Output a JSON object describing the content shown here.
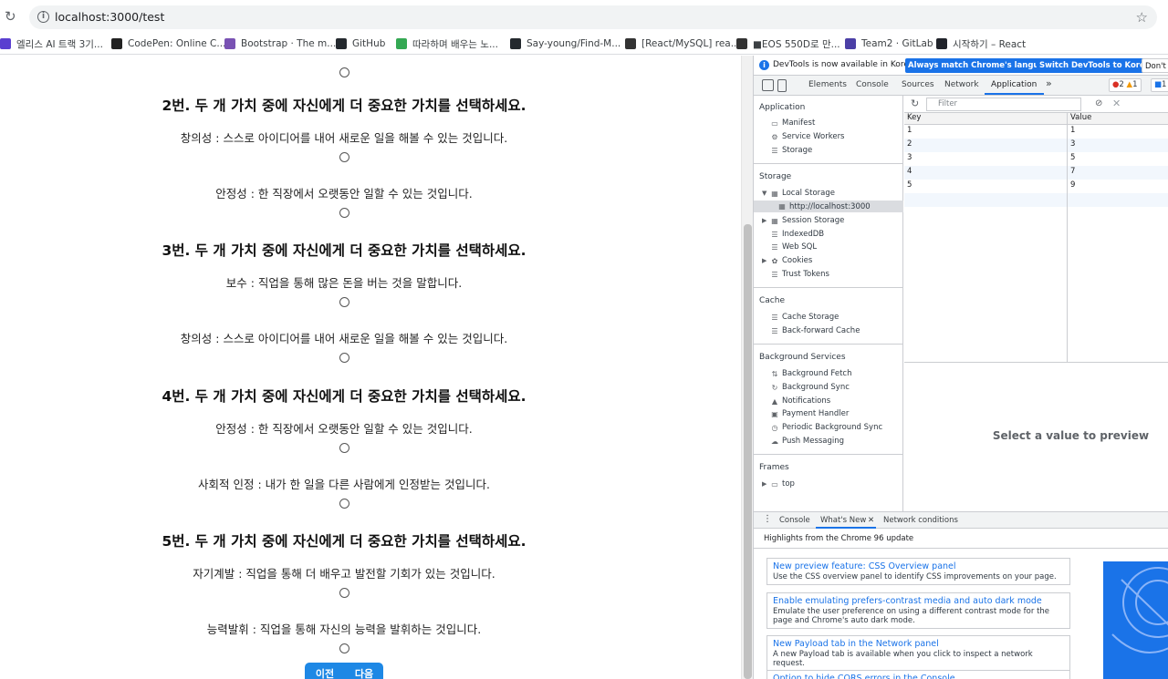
{
  "browser": {
    "url": "localhost:3000/test",
    "bookmarks": [
      {
        "label": "엘리스 AI 트랙 3기...",
        "icon": "elice-icon",
        "color": "#5a3fd0"
      },
      {
        "label": "CodePen: Online C...",
        "icon": "codepen-icon",
        "color": "#222222"
      },
      {
        "label": "Bootstrap · The m...",
        "icon": "bootstrap-icon",
        "color": "#7952b3"
      },
      {
        "label": "GitHub",
        "icon": "github-icon",
        "color": "#24292e"
      },
      {
        "label": "따라하며 배우는 노...",
        "icon": "leaf-icon",
        "color": "#34a853"
      },
      {
        "label": "Say-young/Find-M...",
        "icon": "github-icon",
        "color": "#24292e"
      },
      {
        "label": "[React/MySQL] rea...",
        "icon": "velog-icon",
        "color": "#333333"
      },
      {
        "label": "■EOS 550D로 만...",
        "icon": "velog-icon",
        "color": "#333333"
      },
      {
        "label": "Team2 · GitLab",
        "icon": "gitlab-icon",
        "color": "#4b3fa6"
      },
      {
        "label": "시작하기 – React",
        "icon": "react-icon",
        "color": "#20232a"
      }
    ]
  },
  "test": {
    "questions": [
      {
        "title": "2번. 두 개 가치 중에 자신에게 더 중요한 가치를 선택하세요.",
        "options": [
          "창의성 : 스스로 아이디어를 내어 새로운 일을 해볼 수 있는 것입니다.",
          "안정성 : 한 직장에서 오랫동안 일할 수 있는 것입니다."
        ]
      },
      {
        "title": "3번. 두 개 가치 중에 자신에게 더 중요한 가치를 선택하세요.",
        "options": [
          "보수 : 직업을 통해 많은 돈을 버는 것을 말합니다.",
          "창의성 : 스스로 아이디어를 내어 새로운 일을 해볼 수 있는 것입니다."
        ]
      },
      {
        "title": "4번. 두 개 가치 중에 자신에게 더 중요한 가치를 선택하세요.",
        "options": [
          "안정성 : 한 직장에서 오랫동안 일할 수 있는 것입니다.",
          "사회적 인정 : 내가 한 일을 다른 사람에게 인정받는 것입니다."
        ]
      },
      {
        "title": "5번. 두 개 가치 중에 자신에게 더 중요한 가치를 선택하세요.",
        "options": [
          "자기계발 : 직업을 통해 더 배우고 발전할 기회가 있는 것입니다.",
          "능력발휘 : 직업을 통해 자신의 능력을 발휘하는 것입니다."
        ]
      }
    ],
    "prev_label": "이전",
    "next_label": "다음"
  },
  "devtools": {
    "infobar": {
      "message": "DevTools is now available in Korean!",
      "match_label": "Always match Chrome's language",
      "switch_label": "Switch DevTools to Korean",
      "dont_label": "Don't s"
    },
    "tabs": [
      "Elements",
      "Console",
      "Sources",
      "Network",
      "Application"
    ],
    "more": "»",
    "errors": "2",
    "warnings": "1",
    "messages": "1",
    "sidebar": {
      "application_title": "Application",
      "application_items": [
        "Manifest",
        "Service Workers",
        "Storage"
      ],
      "storage_title": "Storage",
      "local_storage": "Local Storage",
      "local_origin": "http://localhost:3000",
      "storage_items": [
        "Session Storage",
        "IndexedDB",
        "Web SQL",
        "Cookies",
        "Trust Tokens"
      ],
      "cache_title": "Cache",
      "cache_items": [
        "Cache Storage",
        "Back-forward Cache"
      ],
      "bg_title": "Background Services",
      "bg_items": [
        "Background Fetch",
        "Background Sync",
        "Notifications",
        "Payment Handler",
        "Periodic Background Sync",
        "Push Messaging"
      ],
      "frames_title": "Frames",
      "frames_items": [
        "top"
      ]
    },
    "filter_placeholder": "Filter",
    "table": {
      "key_header": "Key",
      "value_header": "Value",
      "rows": [
        {
          "key": "1",
          "value": "1"
        },
        {
          "key": "2",
          "value": "3"
        },
        {
          "key": "3",
          "value": "5"
        },
        {
          "key": "4",
          "value": "7"
        },
        {
          "key": "5",
          "value": "9"
        }
      ]
    },
    "preview_message": "Select a value to preview",
    "drawer": {
      "tabs": [
        "Console",
        "What's New",
        "Network conditions"
      ],
      "highlights": "Highlights from the Chrome 96 update",
      "cards": [
        {
          "title": "New preview feature: CSS Overview panel",
          "desc": "Use the CSS overview panel to identify CSS improvements on your page."
        },
        {
          "title": "Enable emulating prefers-contrast media and auto dark mode",
          "desc": "Emulate the user preference on using a different contrast mode for the page and Chrome's auto dark mode."
        },
        {
          "title": "New Payload tab in the Network panel",
          "desc": "A new Payload tab is available when you click to inspect a network request."
        },
        {
          "title": "Option to hide CORS errors in the Console",
          "desc": ""
        }
      ]
    }
  }
}
